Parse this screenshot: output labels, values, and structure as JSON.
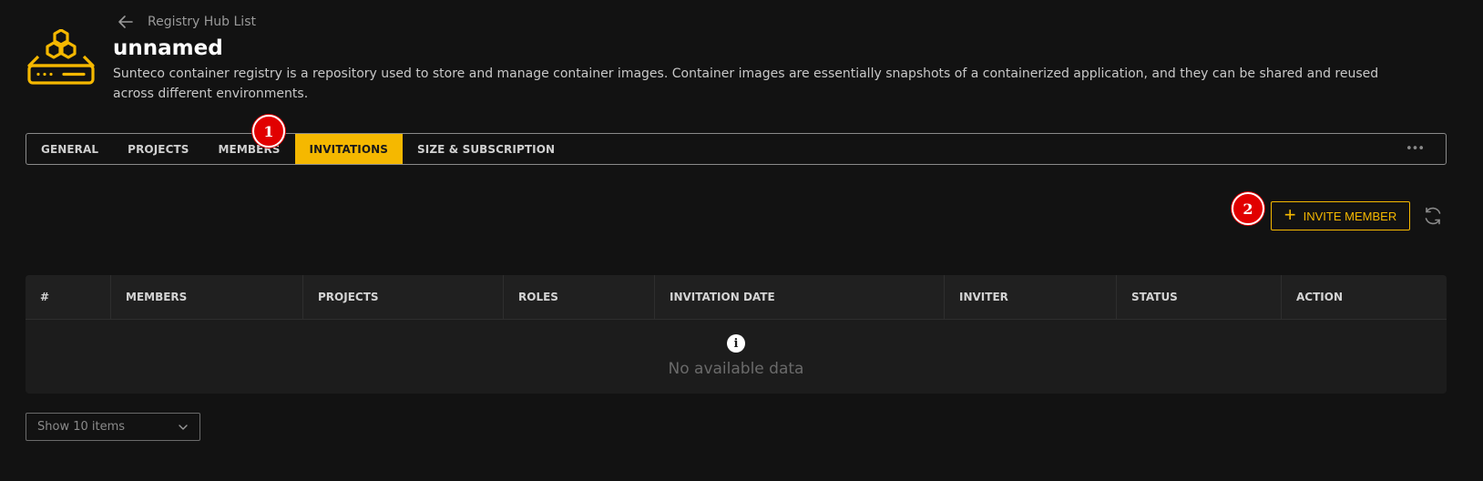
{
  "header": {
    "back_label": "Registry Hub List",
    "title": "unnamed",
    "description": "Sunteco container registry is a repository used to store and manage container images. Container images are essentially snapshots of a containerized application, and they can be shared and reused across different environments."
  },
  "tabs": [
    {
      "label": "GENERAL",
      "active": false
    },
    {
      "label": "PROJECTS",
      "active": false
    },
    {
      "label": "MEMBERS",
      "active": false
    },
    {
      "label": "INVITATIONS",
      "active": true
    },
    {
      "label": "SIZE & SUBSCRIPTION",
      "active": false
    }
  ],
  "tabs_more": "•••",
  "annotations": {
    "badge1": "1",
    "badge2": "2"
  },
  "toolbar": {
    "invite_label": "INVITE MEMBER"
  },
  "table": {
    "columns": [
      "#",
      "MEMBERS",
      "PROJECTS",
      "ROLES",
      "INVITATION DATE",
      "INVITER",
      "STATUS",
      "ACTION"
    ],
    "rows": [],
    "empty_icon": "i",
    "empty_text": "No available data"
  },
  "pager": {
    "page_size_label": "Show 10 items"
  },
  "icons": {
    "back": "arrow-left-icon",
    "logo": "registry-hub-icon",
    "refresh": "refresh-icon",
    "dropdown": "chevron-down-icon"
  },
  "colors": {
    "accent": "#f5b800",
    "background": "#121212",
    "badge": "#e10000"
  }
}
